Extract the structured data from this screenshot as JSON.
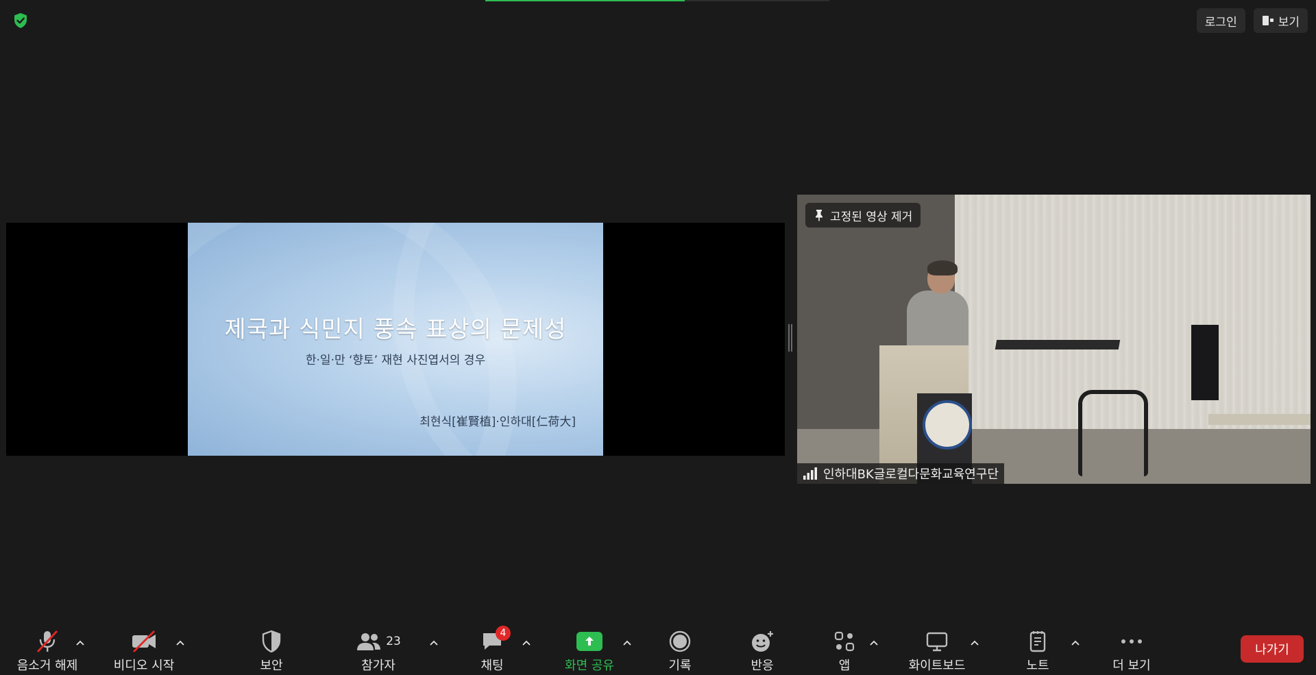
{
  "top_bar": {
    "progress_fraction": 0.58,
    "login_label": "로그인",
    "view_label": "보기"
  },
  "shared_slide": {
    "title": "제국과 식민지 풍속 표상의 문제성",
    "subtitle": "한·일·만 ‘향토’ 재현 사진엽서의 경우",
    "author": "최현식[崔賢植]·인하대[仁荷大]"
  },
  "video_tile": {
    "pin_label": "고정된 영상 제거",
    "participant_name": "인하대BK글로컬다문화교육연구단"
  },
  "toolbar": {
    "unmute_label": "음소거 해제",
    "start_video_label": "비디오 시작",
    "security_label": "보안",
    "participants_label": "참가자",
    "participants_count": "23",
    "chat_label": "채팅",
    "chat_badge": "4",
    "share_label": "화면 공유",
    "record_label": "기록",
    "reactions_label": "반응",
    "apps_label": "앱",
    "whiteboard_label": "화이트보드",
    "notes_label": "노트",
    "more_label": "더 보기",
    "leave_label": "나가기"
  },
  "colors": {
    "background": "#1a1a1a",
    "accent_green": "#2dbd51",
    "leave_red": "#c72a2a",
    "badge_red": "#e02828"
  }
}
